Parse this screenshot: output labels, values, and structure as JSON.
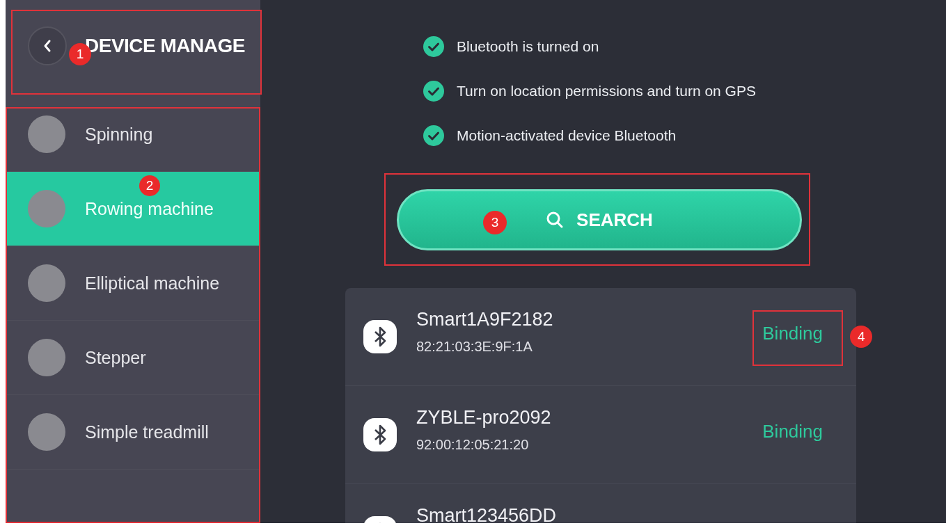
{
  "header": {
    "title": "DEVICE MANAGE",
    "annotation": "1"
  },
  "sidebar": {
    "annotation": "2",
    "items": [
      {
        "label": "Spinning",
        "selected": false
      },
      {
        "label": "Rowing machine",
        "selected": true
      },
      {
        "label": "Elliptical machine",
        "selected": false
      },
      {
        "label": "Stepper",
        "selected": false
      },
      {
        "label": "Simple treadmill",
        "selected": false
      }
    ]
  },
  "checklist": [
    {
      "text": "Bluetooth is turned on",
      "checked": true
    },
    {
      "text": "Turn on location permissions and turn on GPS",
      "checked": true
    },
    {
      "text": "Motion-activated device Bluetooth",
      "checked": true
    }
  ],
  "search_button": {
    "label": "SEARCH",
    "annotation": "3"
  },
  "devices": [
    {
      "name": "Smart1A9F2182",
      "address": "82:21:03:3E:9F:1A",
      "action": "Binding",
      "annotation": "4"
    },
    {
      "name": "ZYBLE-pro2092",
      "address": "92:00:12:05:21:20",
      "action": "Binding"
    },
    {
      "name": "Smart123456DD"
    }
  ]
}
